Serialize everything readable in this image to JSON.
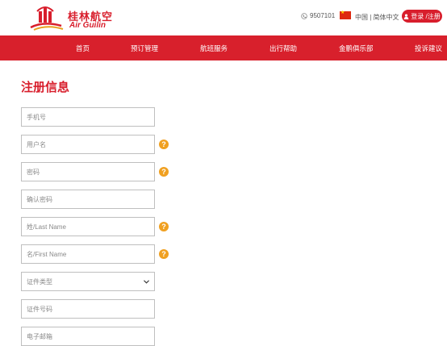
{
  "header": {
    "logo_cn": "桂林航空",
    "logo_en": "Air Guilin",
    "hotline": "9507101",
    "language": "中国 | 简体中文",
    "login_label": "登录 /注册"
  },
  "nav": {
    "items": [
      {
        "label": "首页"
      },
      {
        "label": "预订管理"
      },
      {
        "label": "航班服务"
      },
      {
        "label": "出行帮助"
      },
      {
        "label": "金鹏俱乐部"
      },
      {
        "label": "投诉建议"
      }
    ]
  },
  "form": {
    "title": "注册信息",
    "fields": [
      {
        "placeholder": "手机号"
      },
      {
        "placeholder": "用户名"
      },
      {
        "placeholder": "密码"
      },
      {
        "placeholder": "确认密码"
      },
      {
        "placeholder": "姓/Last Name"
      },
      {
        "placeholder": "名/First Name"
      },
      {
        "placeholder": "证件类型"
      },
      {
        "placeholder": "证件号码"
      },
      {
        "placeholder": "电子邮箱"
      }
    ],
    "help_glyph": "?"
  },
  "colors": {
    "brand_red": "#d81e2c",
    "help_orange": "#f0a020"
  },
  "icons": [
    "logo-mark-icon",
    "phone-icon",
    "china-flag-icon",
    "user-icon",
    "chevron-down-icon",
    "help-icon"
  ]
}
